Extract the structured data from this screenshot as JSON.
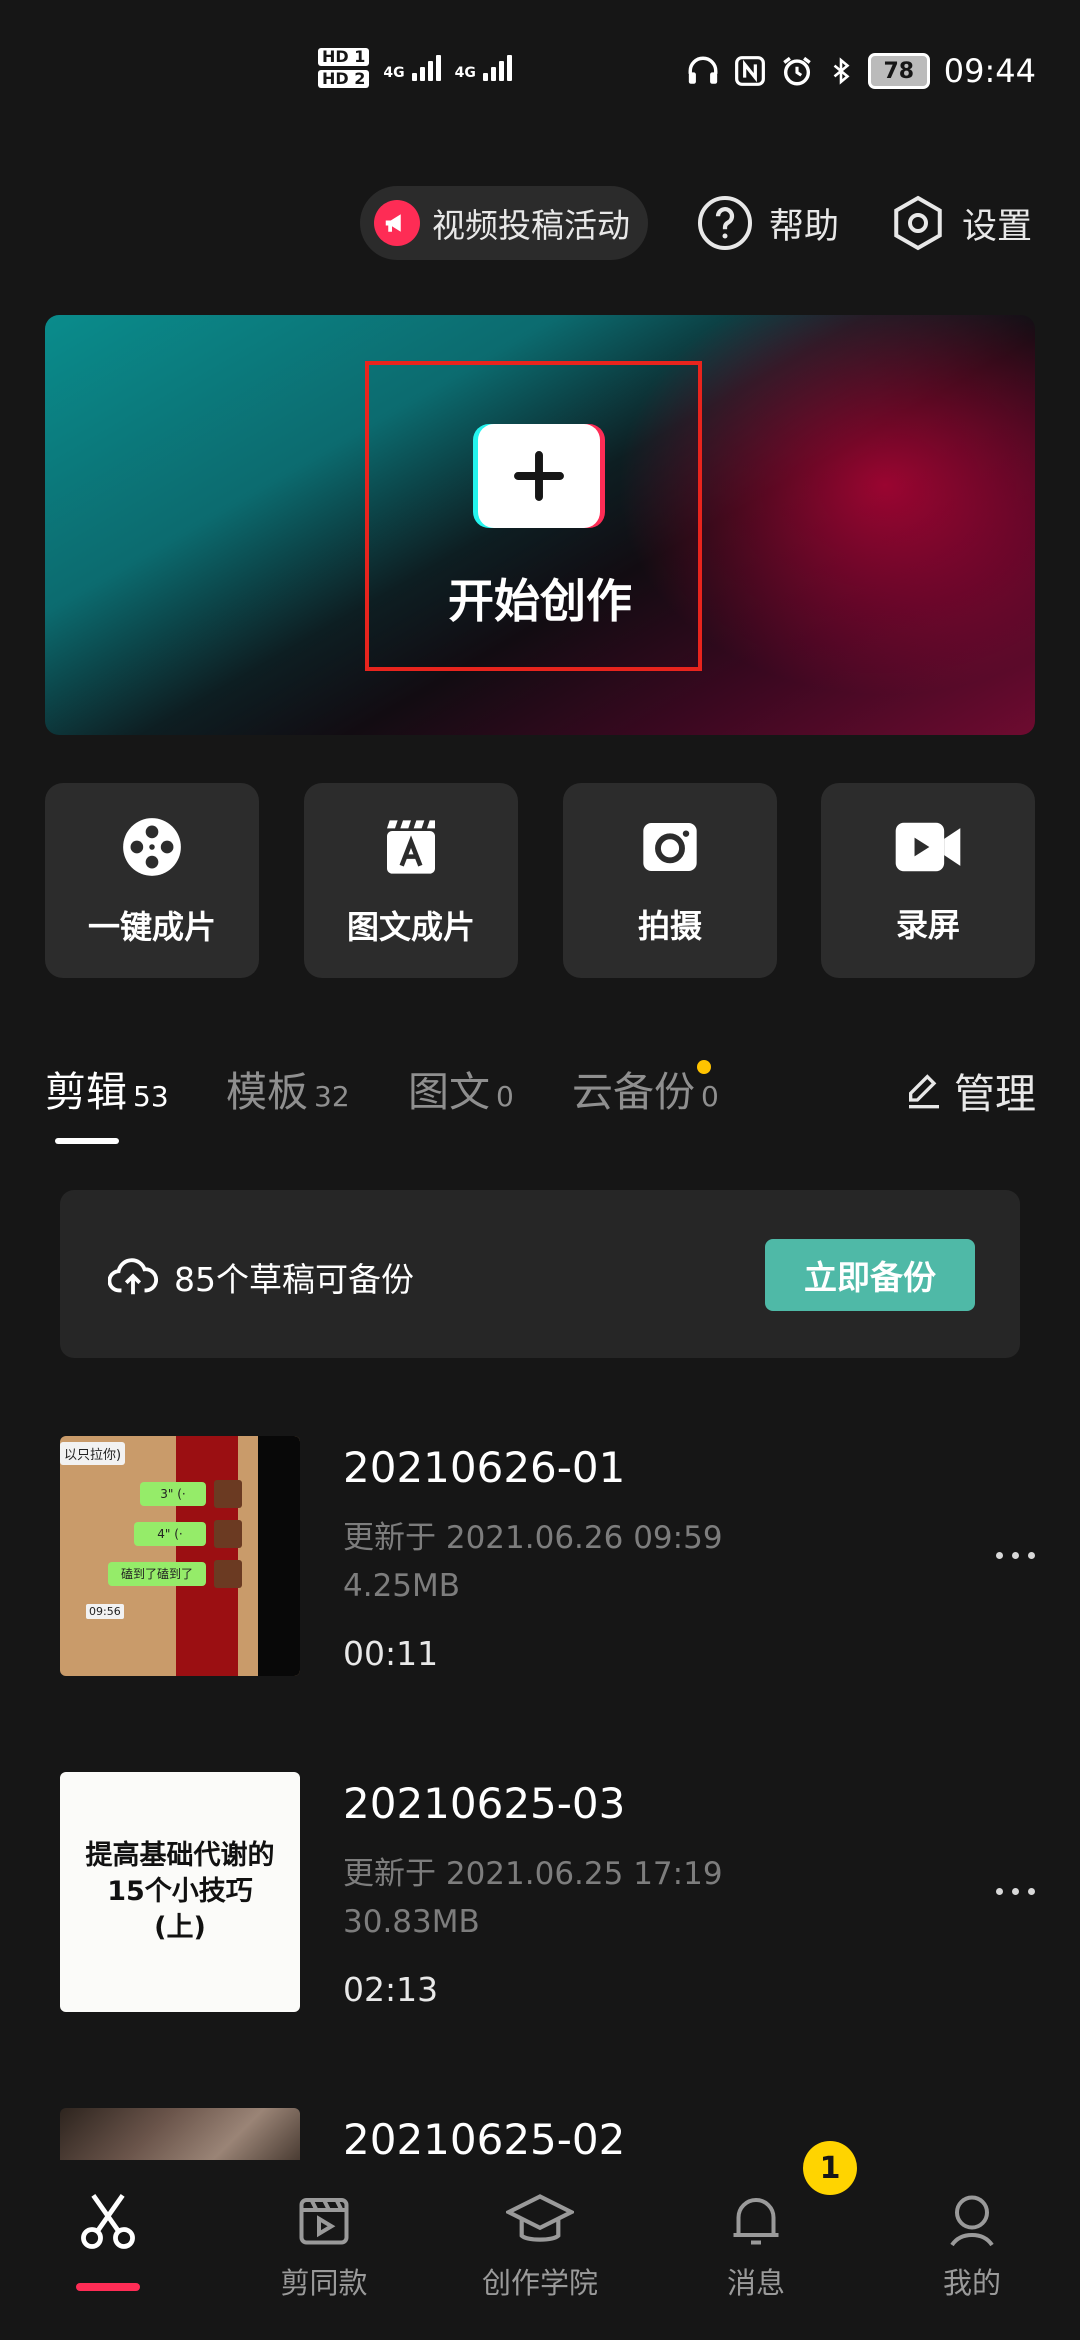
{
  "status_bar": {
    "time": "09:44",
    "battery": "78",
    "network_1": "4G",
    "network_2": "4G",
    "sim_1": "HD 1",
    "sim_2": "HD 2"
  },
  "top_actions": {
    "promo_label": "视频投稿活动",
    "help_label": "帮助",
    "settings_label": "设置"
  },
  "hero": {
    "label": "开始创作"
  },
  "quick_actions": [
    {
      "label": "一键成片",
      "icon": "film-reel-icon"
    },
    {
      "label": "图文成片",
      "icon": "text-clapboard-icon"
    },
    {
      "label": "拍摄",
      "icon": "camera-icon"
    },
    {
      "label": "录屏",
      "icon": "video-camera-icon"
    }
  ],
  "tabs": [
    {
      "label": "剪辑",
      "count": "53",
      "active": true
    },
    {
      "label": "模板",
      "count": "32",
      "active": false
    },
    {
      "label": "图文",
      "count": "0",
      "active": false
    },
    {
      "label": "云备份",
      "count": "0",
      "active": false,
      "dot": true
    }
  ],
  "manage_label": "管理",
  "backup": {
    "text": "85个草稿可备份",
    "button": "立即备份"
  },
  "drafts": [
    {
      "title": "20210626-01",
      "updated": "更新于 2021.06.26 09:59",
      "size": "4.25MB",
      "duration": "00:11",
      "thumb": {
        "tag": "以只拉你)",
        "bubble_1": "3\" (·",
        "bubble_2": "4\" (·",
        "bubble_3": "磕到了磕到了",
        "time": "09:56"
      }
    },
    {
      "title": "20210625-03",
      "updated": "更新于 2021.06.25 17:19",
      "size": "30.83MB",
      "duration": "02:13",
      "thumb": {
        "line_1": "提高基础代谢的",
        "line_2": "15个小技巧",
        "line_3": "(上)"
      }
    },
    {
      "title": "20210625-02"
    }
  ],
  "bottom_nav": [
    {
      "label": "",
      "icon": "scissors-icon",
      "active": true
    },
    {
      "label": "剪同款",
      "icon": "play-clapboard-icon"
    },
    {
      "label": "创作学院",
      "icon": "graduation-cap-icon"
    },
    {
      "label": "消息",
      "icon": "bell-icon",
      "badge": "1"
    },
    {
      "label": "我的",
      "icon": "person-icon"
    }
  ],
  "colors": {
    "background": "#161616",
    "accent": "#fe2c55",
    "cyan": "#25f4ee",
    "backup_button": "#4fb9a7",
    "badge": "#ffd400",
    "highlight_frame": "#e8241d"
  }
}
